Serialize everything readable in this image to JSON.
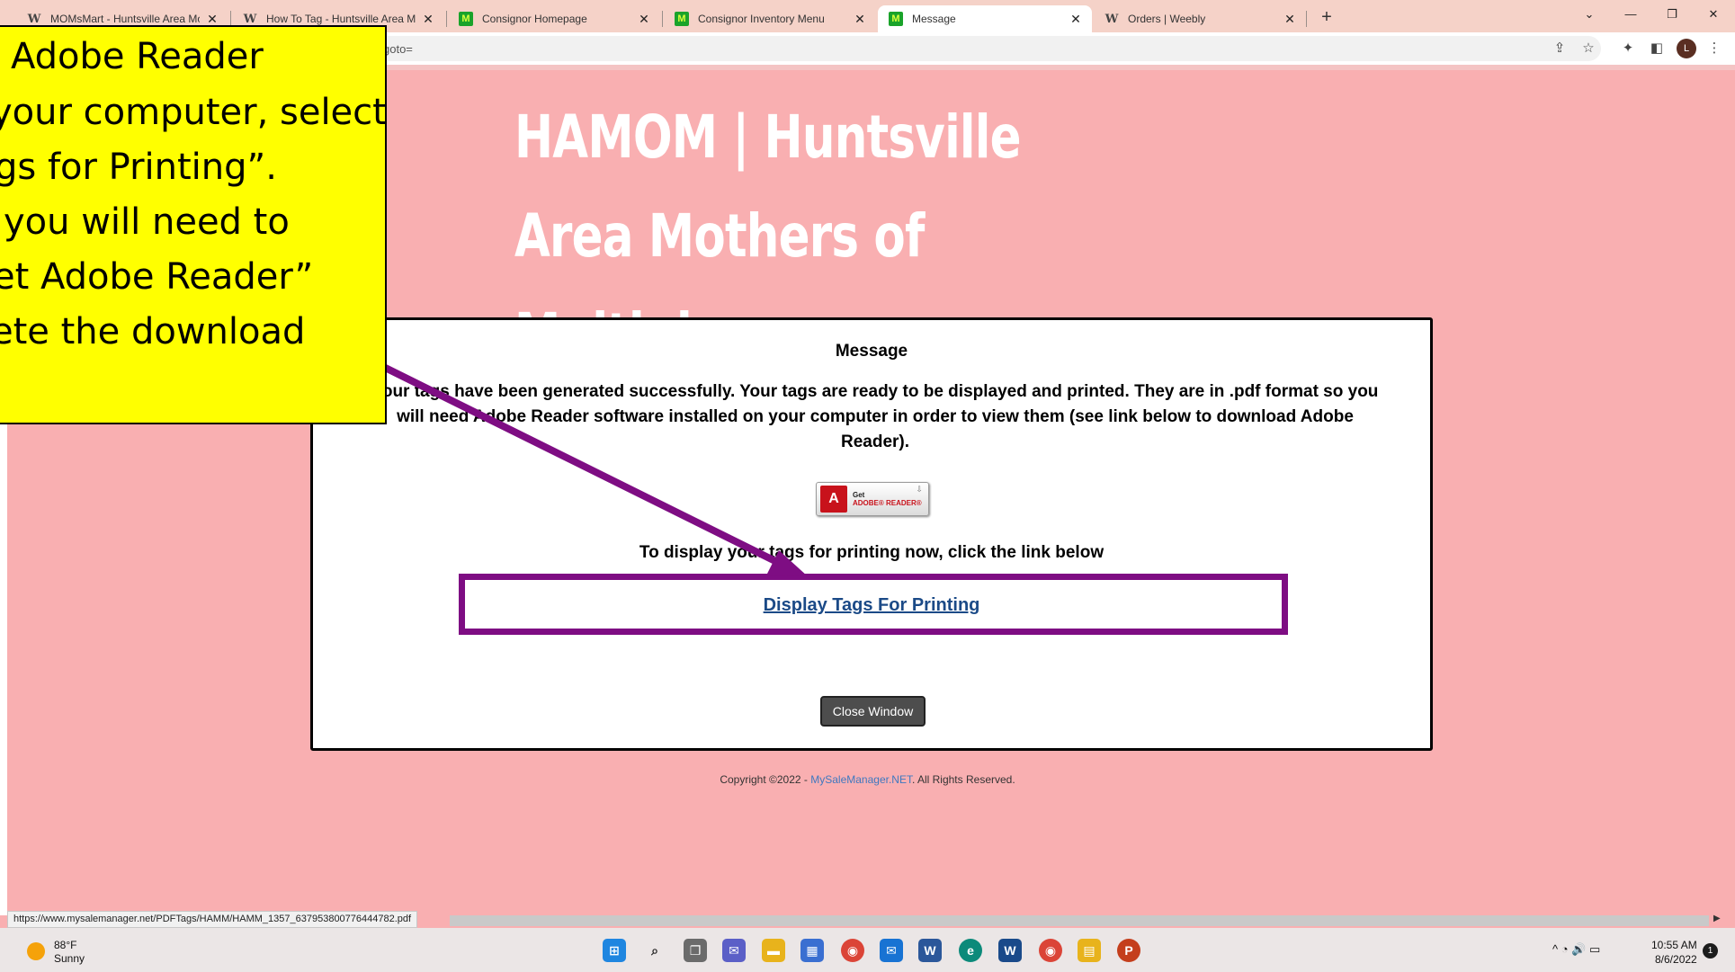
{
  "browser": {
    "tabs": [
      {
        "label": "MOMsMart - Huntsville Area Mo",
        "favicon": "weebly-w-icon"
      },
      {
        "label": "How To Tag - Huntsville Area Mo",
        "favicon": "weebly-w-icon"
      },
      {
        "label": "Consignor Homepage",
        "favicon": "mysalemanager-m-icon"
      },
      {
        "label": "Consignor Inventory Menu",
        "favicon": "mysalemanager-m-icon"
      },
      {
        "label": "Message",
        "favicon": "mysalemanager-m-icon",
        "active": true
      },
      {
        "label": "Orders | Weebly",
        "favicon": "weebly-w-icon"
      }
    ],
    "tab_close_glyph": "✕",
    "new_tab_glyph": "+",
    "window_controls": {
      "dropdown": "⌄",
      "minimize": "—",
      "restore": "❐",
      "close": "✕"
    },
    "url_fragment": "goto=",
    "profile_initial": "L",
    "status_url": "https://www.mysalemanager.net/PDFTags/HAMM/HAMM_1357_637953800776444782.pdf"
  },
  "page": {
    "site_title": "HAMOM | Huntsville Area Mothers of Multiples",
    "message_heading": "Message",
    "message_body": "Your tags have been generated successfully. Your tags are ready to be displayed and printed. They are in .pdf format so you will need Adobe Reader software installed on your computer in order to view them (see link below to download Adobe Reader).",
    "adobe_button": {
      "line1": "Get",
      "line2": "ADOBE® READER®",
      "logo_glyph": "A"
    },
    "display_instruction": "To display your tags for printing now, click the link below",
    "display_link": "Display Tags For Printing",
    "close_button": "Close Window",
    "copyright_prefix": "Copyright ©2022 - ",
    "copyright_link": "MySaleManager.NET",
    "copyright_suffix": ". All Rights Reserved."
  },
  "callout": {
    "lines": [
      "Adobe Reader",
      "your computer, select",
      "gs for Printing”.",
      " you will need to",
      "et Adobe Reader”",
      "ete the download"
    ],
    "colors": {
      "background": "#ffff00",
      "annotation": "#7e0d83"
    }
  },
  "taskbar": {
    "weather_temp": "88°F",
    "weather_condition": "Sunny",
    "time": "10:55 AM",
    "date": "8/6/2022",
    "notification_count": "1",
    "tray_glyphs": "^  ◔  🔊  ▭"
  }
}
